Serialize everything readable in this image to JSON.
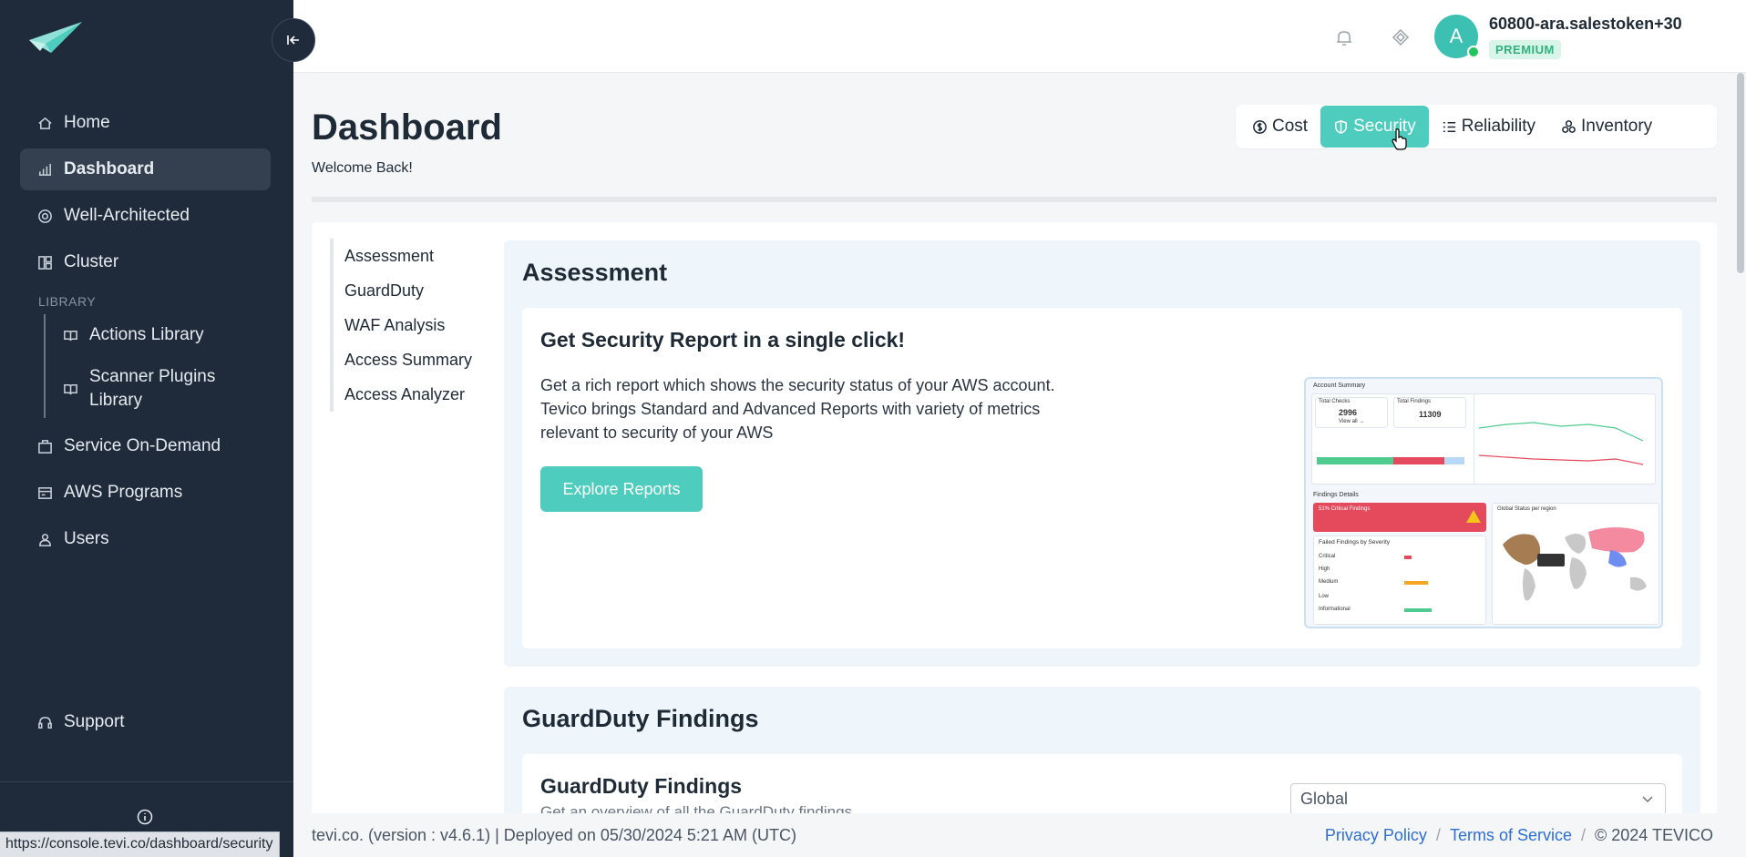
{
  "sidebar": {
    "items": [
      {
        "label": "Home",
        "icon": "home-icon"
      },
      {
        "label": "Dashboard",
        "icon": "chart-icon",
        "active": true
      },
      {
        "label": "Well-Architected",
        "icon": "target-icon"
      },
      {
        "label": "Cluster",
        "icon": "grid-icon"
      }
    ],
    "library_label": "LIBRARY",
    "library_items": [
      {
        "label": "Actions Library",
        "icon": "book-icon"
      },
      {
        "label": "Scanner Plugins Library",
        "icon": "book-icon"
      }
    ],
    "items_after": [
      {
        "label": "Service On-Demand",
        "icon": "briefcase-icon"
      },
      {
        "label": "AWS Programs",
        "icon": "card-icon"
      },
      {
        "label": "Users",
        "icon": "user-icon"
      }
    ],
    "support_label": "Support"
  },
  "header": {
    "avatar_letter": "A",
    "username": "60800-ara.salestoken+30",
    "plan": "PREMIUM"
  },
  "page": {
    "title": "Dashboard",
    "welcome": "Welcome Back!",
    "tabs": [
      {
        "label": "Cost",
        "icon": "dollar-icon"
      },
      {
        "label": "Security",
        "icon": "shield-icon",
        "active": true
      },
      {
        "label": "Reliability",
        "icon": "list-icon"
      },
      {
        "label": "Inventory",
        "icon": "cubes-icon"
      }
    ]
  },
  "subnav": [
    "Assessment",
    "GuardDuty",
    "WAF Analysis",
    "Access Summary",
    "Access Analyzer"
  ],
  "assessment": {
    "section_title": "Assessment",
    "card_title": "Get Security Report in a single click!",
    "description": "Get a rich report which shows the security status of your AWS account. Tevico brings Standard and Advanced Reports with variety of metrics relevant to security of your AWS",
    "button": "Explore Reports",
    "preview": {
      "account_summary": "Account Summary",
      "total_checks_label": "Total Checks",
      "total_checks": "2996",
      "total_findings_label": "Total Findings",
      "total_findings": "11309",
      "view_all": "View all →",
      "findings_details": "Findings Details",
      "critical_findings": "51% Critical Findings",
      "failed_by_severity": "Failed Findings by Severity",
      "global_status": "Global Status per region",
      "severities": [
        "Critical",
        "High",
        "Medium",
        "Low",
        "Informational"
      ]
    }
  },
  "guardduty": {
    "section_title": "GuardDuty Findings",
    "card_title": "GuardDuty Findings",
    "card_sub": "Get an overview of all the GuardDuty findings",
    "select_value": "Global"
  },
  "footer": {
    "left": "tevi.co. (version : v4.6.1) | Deployed on 05/30/2024 5:21 AM (UTC)",
    "privacy": "Privacy Policy",
    "terms": "Terms of Service",
    "copyright": "© 2024 TEVICO"
  },
  "status_url": "https://console.tevi.co/dashboard/security",
  "colors": {
    "accent": "#4ecdbf",
    "sidebar": "#1f2a3a",
    "premium": "#2fb27f"
  }
}
